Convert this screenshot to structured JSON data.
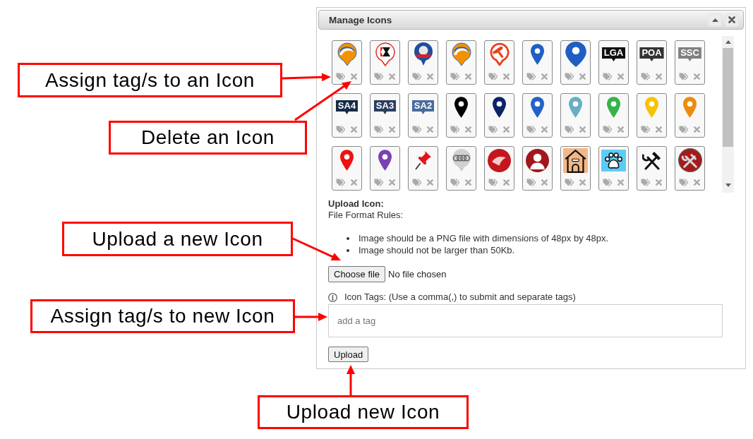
{
  "dialog": {
    "title": "Manage Icons"
  },
  "icons": [
    {
      "kind": "swirl"
    },
    {
      "kind": "tyre"
    },
    {
      "kind": "mascot"
    },
    {
      "kind": "swirl"
    },
    {
      "kind": "hammer"
    },
    {
      "kind": "pin",
      "color": "#1f5fc4"
    },
    {
      "kind": "bigpin",
      "color": "#1f5fc4"
    },
    {
      "kind": "label",
      "label": "LGA",
      "color": "#111111"
    },
    {
      "kind": "label",
      "label": "POA",
      "color": "#333333"
    },
    {
      "kind": "label",
      "label": "SSC",
      "color": "#808080"
    },
    {
      "kind": "label",
      "label": "SA4",
      "color": "#172b47"
    },
    {
      "kind": "label",
      "label": "SA3",
      "color": "#2a3f5f"
    },
    {
      "kind": "label",
      "label": "SA2",
      "color": "#4a6a9c"
    },
    {
      "kind": "pin",
      "color": "#000000"
    },
    {
      "kind": "pin",
      "color": "#0c2466"
    },
    {
      "kind": "pin",
      "color": "#2462c9"
    },
    {
      "kind": "pin",
      "color": "#67afc8"
    },
    {
      "kind": "pin",
      "color": "#37b34a"
    },
    {
      "kind": "pin",
      "color": "#f7c200"
    },
    {
      "kind": "pin",
      "color": "#ee8a0c"
    },
    {
      "kind": "pin",
      "color": "#ee1111"
    },
    {
      "kind": "pin",
      "color": "#7b40b3"
    },
    {
      "kind": "pushpin"
    },
    {
      "kind": "rings"
    },
    {
      "kind": "lion"
    },
    {
      "kind": "portrait"
    },
    {
      "kind": "doghouse"
    },
    {
      "kind": "paw"
    },
    {
      "kind": "tools"
    },
    {
      "kind": "redtools"
    }
  ],
  "upload": {
    "heading": "Upload Icon:",
    "rules_heading": "File Format Rules:",
    "rules": [
      "Image should be a PNG file with dimensions of 48px by 48px.",
      "Image should not be larger than 50Kb."
    ],
    "file_button": "Choose file",
    "file_status": "No file chosen",
    "tags_hint": "Icon Tags: (Use a comma(,) to submit and separate tags)",
    "tags_field": {
      "placeholder": "add a tag"
    },
    "submit_button": "Upload"
  },
  "callouts": [
    "Assign tag/s to an Icon",
    "Delete an Icon",
    "Upload a new Icon",
    "Assign tag/s to new Icon",
    "Upload new Icon"
  ]
}
